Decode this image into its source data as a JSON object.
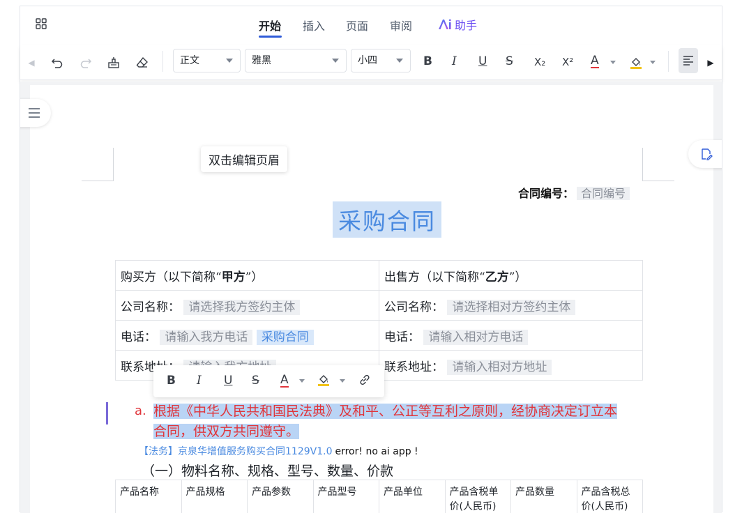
{
  "ribbon": {
    "tabs": [
      {
        "label": "开始",
        "active": true
      },
      {
        "label": "插入",
        "active": false
      },
      {
        "label": "页面",
        "active": false
      },
      {
        "label": "审阅",
        "active": false
      }
    ],
    "assistant_label": "助手",
    "assistant_icon": "ai-icon"
  },
  "toolbar": {
    "style_select": "正文",
    "font_select": "雅黑",
    "size_select": "小四",
    "bold": "B",
    "italic": "I",
    "underline": "U",
    "strikethrough": "S",
    "subscript": "X₂",
    "superscript": "X²",
    "font_color": "A",
    "font_color_hex": "#e0353b",
    "highlight_hex": "#f2c318"
  },
  "document": {
    "header_hint": "双击编辑页眉",
    "contract_no_label": "合同编号：",
    "contract_no_placeholder": "合同编号",
    "title": "采购合同",
    "parties": {
      "buyer_prefix": "购买方（以下简称“",
      "buyer_short": "甲方",
      "seller_prefix": "出售方（以下简称“",
      "seller_short": "乙方",
      "suffix": "”）",
      "company_label": "公司名称：",
      "buyer_company_placeholder": "请选择我方签约主体",
      "seller_company_placeholder": "请选择相对方签约主体",
      "phone_label": "电话：",
      "buyer_phone_placeholder": "请输入我方电话",
      "buyer_phone_tag": "采购合同",
      "seller_phone_placeholder": "请输入相对方电话",
      "address_label": "联系地址：",
      "buyer_address_placeholder": "请输入我方地址",
      "seller_address_placeholder": "请输入相对方地址"
    },
    "clause_marker": "a.",
    "clause_line1": "根据《中华人民共和国民法典》及和平、公正等互利之原则，经协商决定订立本",
    "clause_line2": "合同，供双方共同遵守。",
    "law_ref": "【法务】京泉华增值服务购买合同1129V1.0",
    "error_text": "error! no ai app !",
    "section_heading": "（一）物料名称、规格、型号、数量、价款",
    "product_headers": [
      "产品名称",
      "产品规格",
      "产品参数",
      "产品型号",
      "产品单位",
      "产品含税单价(人民币)",
      "产品数量",
      "产品含税总价(人民币)"
    ]
  },
  "floating_toolbar": {
    "bold": "B",
    "italic": "I",
    "underline": "U",
    "strikethrough": "S",
    "font_color": "A"
  }
}
